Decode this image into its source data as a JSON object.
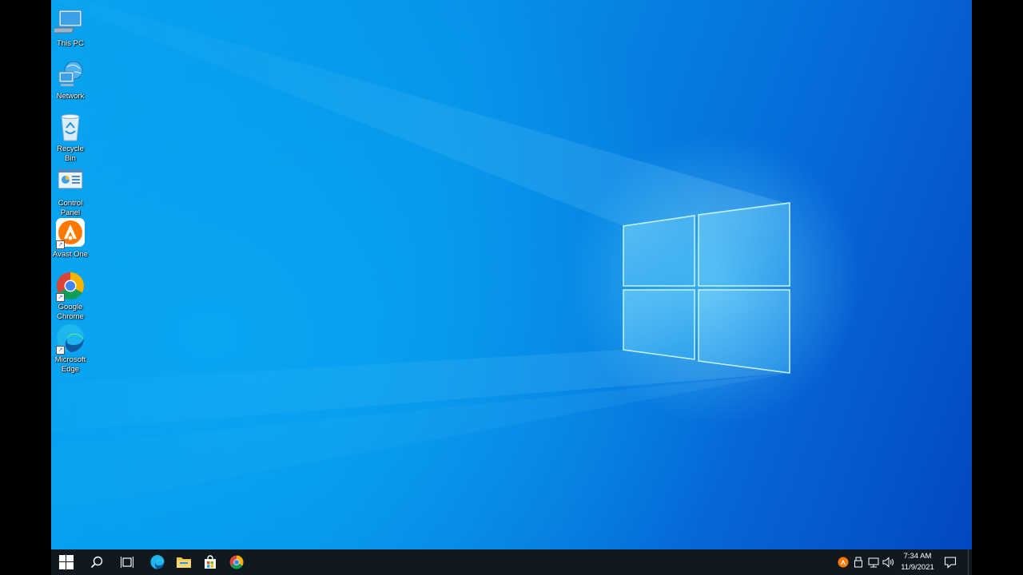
{
  "desktop": {
    "icons": [
      {
        "label": "This PC",
        "icon": "this-pc-icon"
      },
      {
        "label": "Network",
        "icon": "network-icon"
      },
      {
        "label": "Recycle Bin",
        "icon": "recycle-bin-icon"
      },
      {
        "label": "Control Panel",
        "icon": "control-panel-icon"
      },
      {
        "label": "Avast One",
        "icon": "avast-one-icon"
      },
      {
        "label": "Google Chrome",
        "icon": "chrome-icon"
      },
      {
        "label": "Microsoft Edge",
        "icon": "edge-icon"
      }
    ]
  },
  "taskbar": {
    "pinned": [
      "start-icon",
      "search-icon",
      "task-view-icon",
      "edge-icon",
      "file-explorer-icon",
      "store-icon",
      "chrome-icon"
    ],
    "tray": {
      "icons": [
        "avast-tray-icon",
        "usb-icon",
        "network-tray-icon",
        "volume-icon"
      ],
      "time": "7:34 AM",
      "date": "11/9/2021",
      "notification": "action-center-icon"
    }
  },
  "colors": {
    "taskbar": "#101820",
    "wallpaper_light": "#08a3ef",
    "wallpaper_dark": "#0447c0"
  }
}
